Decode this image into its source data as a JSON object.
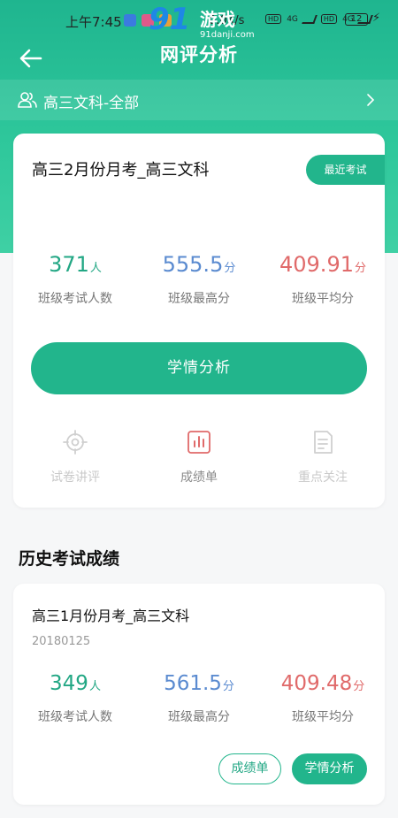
{
  "status_bar": {
    "time": "上午7:45",
    "net_speed": "0.0K/s",
    "battery": "12",
    "network_4g": "4G"
  },
  "watermark": {
    "logo": "91",
    "text": "游戏",
    "url": "91danji.com"
  },
  "header": {
    "title": "网评分析"
  },
  "class_selector": {
    "label": "高三文科-全部"
  },
  "current_exam": {
    "title": "高三2月份月考_高三文科",
    "tag": "最近考试",
    "stats": [
      {
        "value": "371",
        "unit": "人",
        "label": "班级考试人数",
        "color": "#22a784"
      },
      {
        "value": "555.5",
        "unit": "分",
        "label": "班级最高分",
        "color": "#5b8bd0"
      },
      {
        "value": "409.91",
        "unit": "分",
        "label": "班级平均分",
        "color": "#e06a6a"
      }
    ],
    "analyze_button": "学情分析",
    "tools": [
      {
        "label": "试卷讲评",
        "icon": "target-icon"
      },
      {
        "label": "成绩单",
        "icon": "bar-chart-icon"
      },
      {
        "label": "重点关注",
        "icon": "document-icon"
      }
    ]
  },
  "history": {
    "title": "历史考试成绩",
    "items": [
      {
        "title": "高三1月份月考_高三文科",
        "date": "20180125",
        "stats": [
          {
            "value": "349",
            "unit": "人",
            "label": "班级考试人数"
          },
          {
            "value": "561.5",
            "unit": "分",
            "label": "班级最高分"
          },
          {
            "value": "409.48",
            "unit": "分",
            "label": "班级平均分"
          }
        ],
        "buttons": {
          "report_card": "成绩单",
          "analysis": "学情分析"
        }
      }
    ]
  },
  "colors": {
    "primary": "#22b58c",
    "green_text": "#22a784",
    "blue_text": "#5b8bd0",
    "red_text": "#e06a6a"
  }
}
